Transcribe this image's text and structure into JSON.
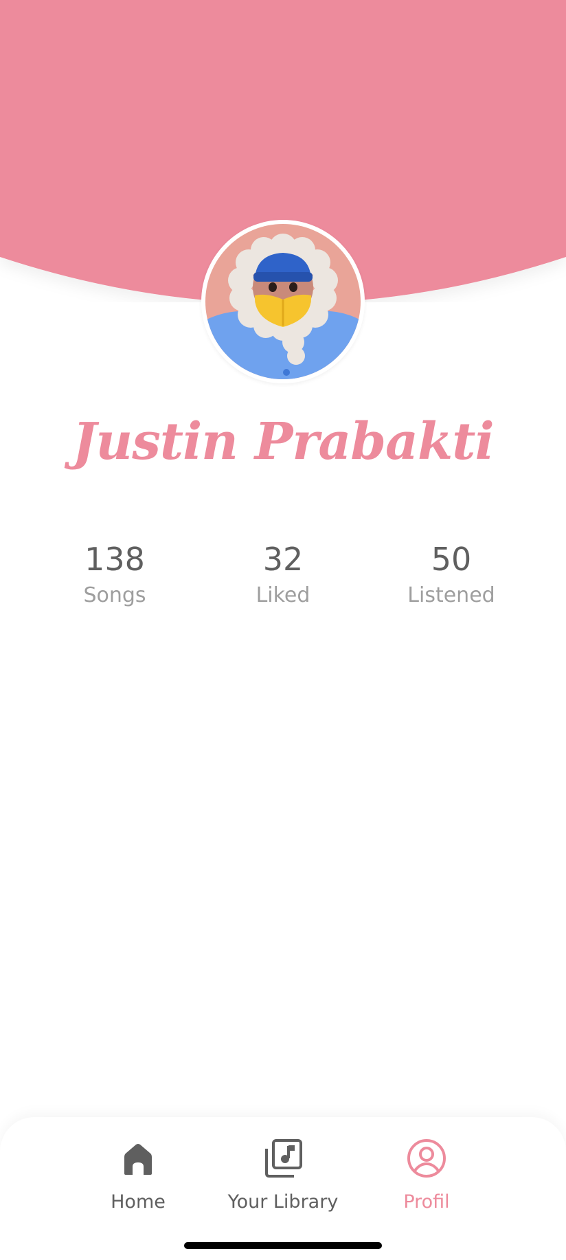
{
  "profile": {
    "name": "Justin Prabakti",
    "avatar_icon": "person-in-winter-hood-avatar"
  },
  "stats": [
    {
      "value": "138",
      "label": "Songs"
    },
    {
      "value": "32",
      "label": "Liked"
    },
    {
      "value": "50",
      "label": "Listened"
    }
  ],
  "nav": {
    "items": [
      {
        "label": "Home",
        "icon": "home-icon",
        "active": false
      },
      {
        "label": "Your Library",
        "icon": "music-library-icon",
        "active": false
      },
      {
        "label": "Profil",
        "icon": "profile-icon",
        "active": true
      }
    ]
  },
  "colors": {
    "accent": "#ed8b9c",
    "text_primary": "#5f5f5f",
    "text_secondary": "#9e9e9e",
    "background": "#ffffff"
  }
}
